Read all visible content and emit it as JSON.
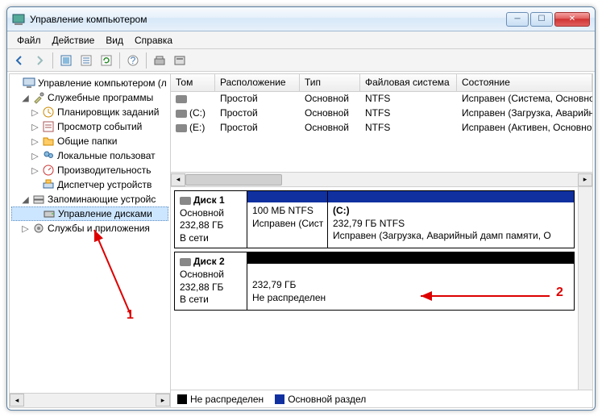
{
  "window": {
    "title": "Управление компьютером"
  },
  "menu": {
    "file": "Файл",
    "action": "Действие",
    "view": "Вид",
    "help": "Справка"
  },
  "tree": {
    "root": "Управление компьютером (л",
    "system_tools": "Служебные программы",
    "scheduler": "Планировщик заданий",
    "event_viewer": "Просмотр событий",
    "shared": "Общие папки",
    "users": "Локальные пользоват",
    "perf": "Производительность",
    "devmgr": "Диспетчер устройств",
    "storage": "Запоминающие устройс",
    "diskmgmt": "Управление дисками",
    "services": "Службы и приложения"
  },
  "grid": {
    "headers": {
      "vol": "Том",
      "layout": "Расположение",
      "type": "Тип",
      "fs": "Файловая система",
      "status": "Состояние"
    },
    "rows": [
      {
        "vol": "",
        "layout": "Простой",
        "type": "Основной",
        "fs": "NTFS",
        "status": "Исправен (Система, Основной р"
      },
      {
        "vol": "(C:)",
        "layout": "Простой",
        "type": "Основной",
        "fs": "NTFS",
        "status": "Исправен (Загрузка, Аварийный"
      },
      {
        "vol": "(E:)",
        "layout": "Простой",
        "type": "Основной",
        "fs": "NTFS",
        "status": "Исправен (Активен, Основной р"
      }
    ]
  },
  "disks": {
    "d1": {
      "name": "Диск 1",
      "type": "Основной",
      "size": "232,88 ГБ",
      "state": "В сети",
      "p1": {
        "line1": "100 МБ NTFS",
        "line2": "Исправен (Сист"
      },
      "p2": {
        "name": "(C:)",
        "line1": "232,79 ГБ NTFS",
        "line2": "Исправен (Загрузка, Аварийный дамп памяти, О"
      }
    },
    "d2": {
      "name": "Диск 2",
      "type": "Основной",
      "size": "232,88 ГБ",
      "state": "В сети",
      "p1": {
        "line1": "232,79 ГБ",
        "line2": "Не распределен"
      }
    }
  },
  "legend": {
    "unalloc": "Не распределен",
    "primary": "Основной раздел"
  },
  "annotations": {
    "one": "1",
    "two": "2"
  }
}
